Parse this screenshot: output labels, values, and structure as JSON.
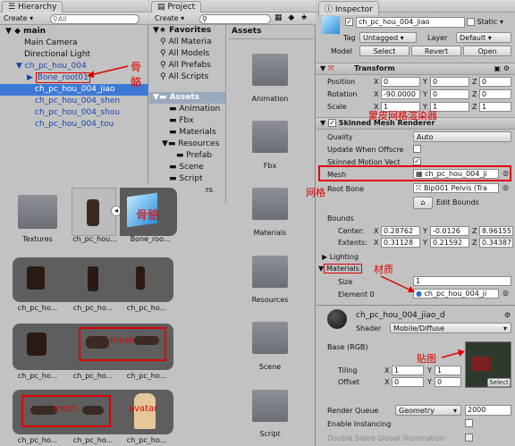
{
  "hierarchy": {
    "tab": "Hierarchy",
    "create": "Create",
    "search": "All",
    "scene": "main",
    "items": [
      "Main Camera",
      "Directional Light",
      "ch_pc_hou_004",
      "Bone_root01",
      "ch_pc_hou_004_jiao",
      "ch_pc_hou_004_shen",
      "ch_pc_hou_004_shou",
      "ch_pc_hou_004_tou"
    ]
  },
  "project": {
    "tab": "Project",
    "create": "Create",
    "favorites": "Favorites",
    "fav_items": [
      "All Materia",
      "All Models",
      "All Prefabs",
      "All Scripts"
    ],
    "assets": "Assets",
    "asset_items": [
      "Animation",
      "Fbx",
      "Materials",
      "Resources",
      "Prefab",
      "Scene",
      "Script",
      "Textures"
    ],
    "grid_title": "Assets",
    "grid_items": [
      "Animation",
      "Fbx",
      "Materials",
      "Resources",
      "Scene",
      "Script"
    ]
  },
  "lower": {
    "row1": [
      "Textures",
      "ch_pc_hou...",
      "Bone_roo..."
    ],
    "row2": [
      "ch_pc_ho...",
      "ch_pc_ho...",
      "ch_pc_ho..."
    ],
    "row3": [
      "ch_pc_ho...",
      "ch_pc_ho...",
      "ch_pc_ho..."
    ],
    "row4": [
      "ch_pc_ho...",
      "ch_pc_ho...",
      "ch_pc_ho..."
    ],
    "mesh_label": "mesh",
    "avatar_label": "avatar"
  },
  "inspector": {
    "tab": "Inspector",
    "name": "ch_pc_hou_004_jiao",
    "static": "Static",
    "tag_label": "Tag",
    "tag": "Untagged",
    "layer_label": "Layer",
    "layer": "Default",
    "model_label": "Model",
    "select": "Select",
    "revert": "Revert",
    "open": "Open",
    "transform": "Transform",
    "position": "Position",
    "rotation": "Rotation",
    "scale": "Scale",
    "pos": [
      "0",
      "0",
      "0"
    ],
    "rot": [
      "-90.0000",
      "0",
      "0"
    ],
    "scl": [
      "1",
      "1",
      "1"
    ],
    "smr": "Skinned Mesh Renderer",
    "quality_label": "Quality",
    "quality": "Auto",
    "update": "Update When Offscre",
    "motion": "Skinned Motion Vect",
    "mesh_label": "Mesh",
    "mesh": "ch_pc_hou_004_ji",
    "root_label": "Root Bone",
    "root": "Bip001 Pelvis (Tra",
    "edit_bounds": "Edit Bounds",
    "bounds": "Bounds",
    "center_label": "Center:",
    "extents_label": "Extents:",
    "center": [
      "0.28762",
      "-0.0126",
      "8.96155"
    ],
    "extents": [
      "0.31128",
      "0.21592",
      "0.34387"
    ],
    "lighting": "Lighting",
    "materials": "Materials",
    "size_label": "Size",
    "size": "1",
    "element_label": "Element 0",
    "element": "ch_pc_hou_004_ji",
    "mat_name": "ch_pc_hou_004_jiao_d",
    "shader_label": "Shader",
    "shader": "Mobile/Diffuse",
    "base": "Base (RGB)",
    "tiling": "Tiling",
    "offset": "Offset",
    "tiling_v": [
      "1",
      "1"
    ],
    "offset_v": [
      "0",
      "0"
    ],
    "select_btn": "Select",
    "rq_label": "Render Queue",
    "rq_mode": "Geometry",
    "rq": "2000",
    "instancing": "Enable Instancing",
    "double": "Double Sided Global Illumination"
  },
  "annotations": {
    "bone": "骨骼",
    "bone2": "骨骼",
    "smr_cn": "蒙皮网格渲染器",
    "mesh_cn": "网格",
    "material_cn": "材质",
    "texture_cn": "贴图"
  }
}
